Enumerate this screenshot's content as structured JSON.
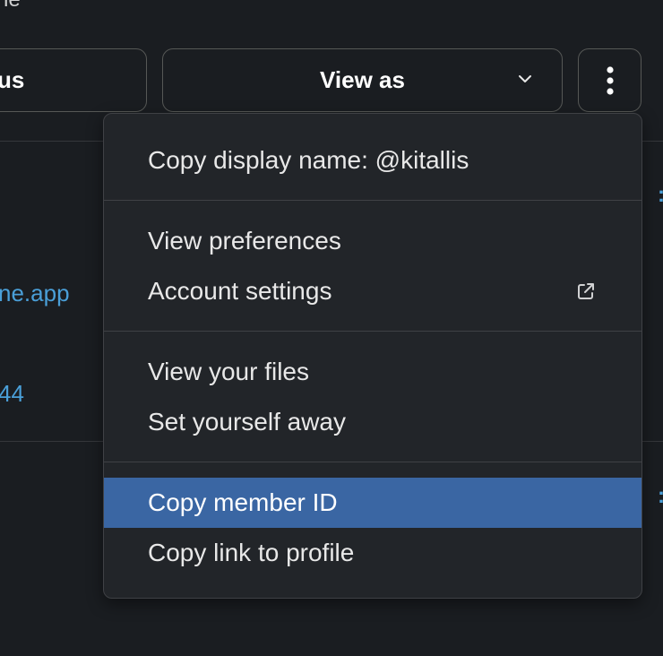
{
  "background": {
    "top_text": "ne",
    "link_1": "ne.app",
    "link_2": "44"
  },
  "buttons": {
    "status_label": "us",
    "view_as_label": "View as",
    "view_as_icon": "chevron-down-icon",
    "more_icon": "vertical-ellipsis-icon"
  },
  "menu": {
    "copy_display_name": "Copy display name: @kitallis",
    "view_preferences": "View preferences",
    "account_settings": "Account settings",
    "account_settings_icon": "external-link-icon",
    "view_your_files": "View your files",
    "set_yourself_away": "Set yourself away",
    "copy_member_id": "Copy member ID",
    "copy_link_to_profile": "Copy link to profile"
  },
  "colors": {
    "background": "#1a1d21",
    "menu_background": "#222529",
    "highlight": "#3a66a3",
    "link": "#4a9fd8"
  }
}
